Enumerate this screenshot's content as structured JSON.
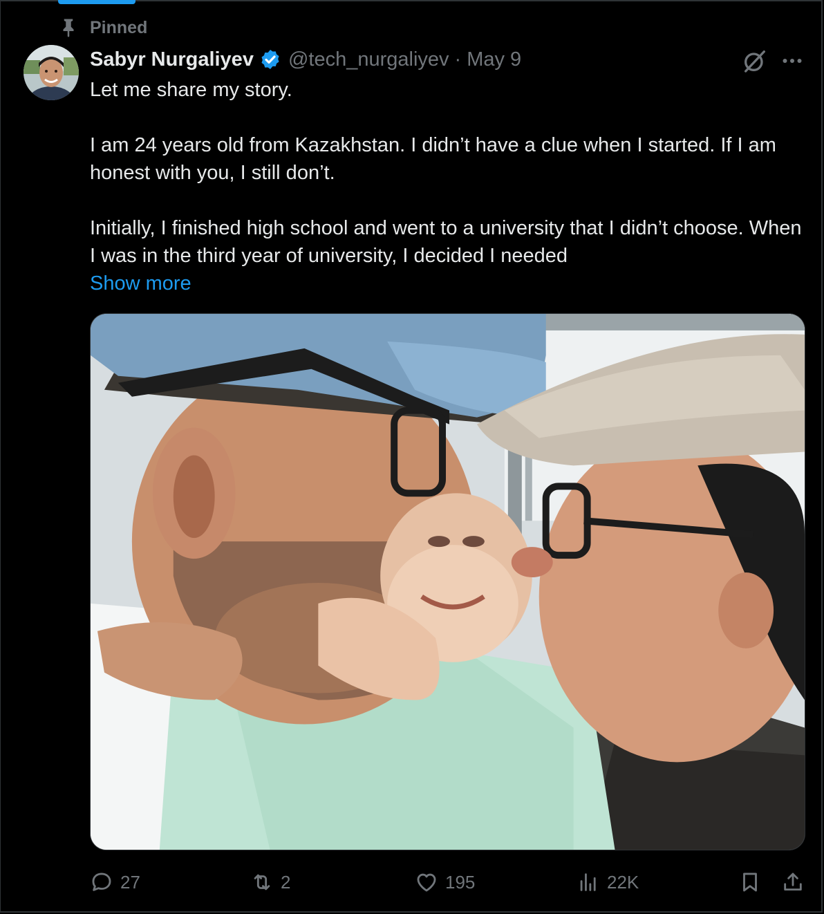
{
  "pinned_label": "Pinned",
  "author": {
    "display_name": "Sabyr Nurgaliyev",
    "handle": "@tech_nurgaliyev",
    "separator": "·",
    "date": "May 9",
    "verified": true
  },
  "tweet": {
    "paragraphs": [
      "Let me share my story.",
      "I am 24 years old from Kazakhstan. I didn’t have a clue when I started. If I am honest with you, I still don’t.",
      "Initially, I finished high school and went to a university that I didn’t choose. When I was in the third year of university, I decided I needed"
    ],
    "show_more": "Show more"
  },
  "actions": {
    "replies": "27",
    "reposts": "2",
    "likes": "195",
    "views": "22K"
  },
  "colors": {
    "background": "#000000",
    "text": "#e7e9ea",
    "muted": "#71767b",
    "accent": "#1d9bf0",
    "border": "#2f3336"
  },
  "icons": {
    "pin": "pin-icon",
    "verified": "verified-badge-icon",
    "grok": "grok-icon",
    "more": "more-icon",
    "reply": "reply-icon",
    "repost": "repost-icon",
    "like": "like-icon",
    "views": "views-icon",
    "bookmark": "bookmark-icon",
    "share": "share-icon"
  }
}
